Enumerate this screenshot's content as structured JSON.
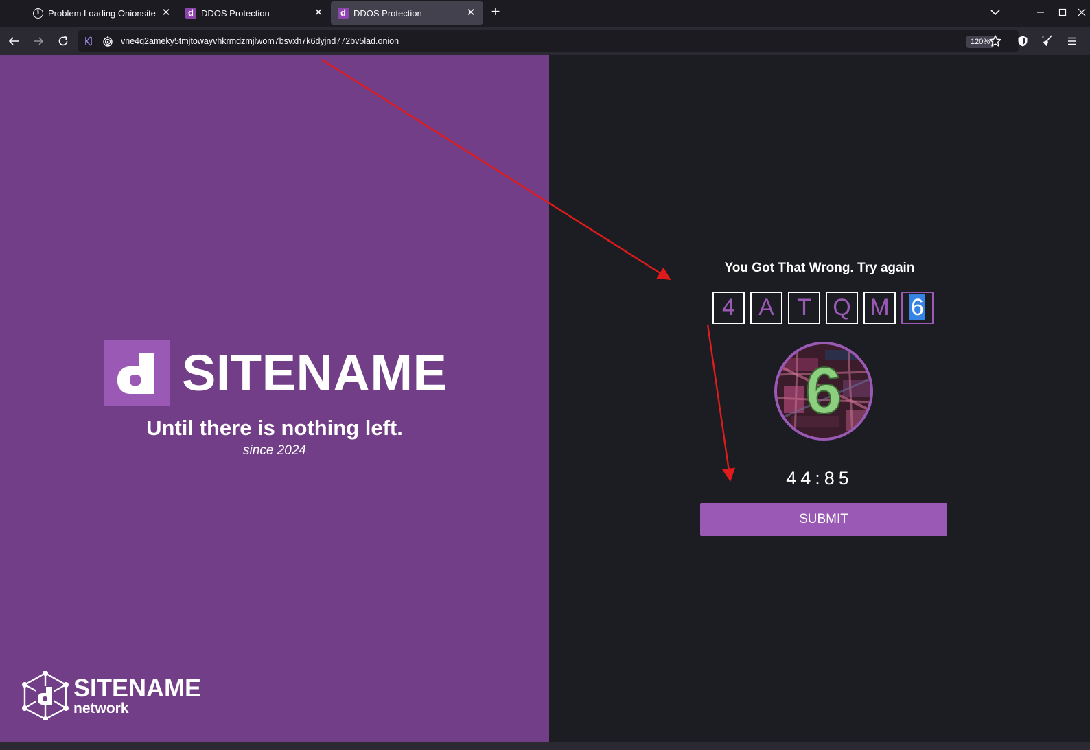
{
  "browser": {
    "tabs": [
      {
        "title": "Problem Loading Onionsite",
        "icon": "info-icon",
        "active": false
      },
      {
        "title": "DDOS Protection",
        "icon": "site-favicon",
        "active": false
      },
      {
        "title": "DDOS Protection",
        "icon": "site-favicon",
        "active": true
      }
    ],
    "favicon_letter": "d",
    "url": "vne4q2ameky5tmjtowayvhkrmdzmjlwom7bsvxh7k6dyjnd772bv5lad.onion",
    "zoom": "120%"
  },
  "left": {
    "logo_letter": "d",
    "site_name": "SITENAME",
    "tagline": "Until there is nothing left.",
    "since": "since 2024",
    "network_name": "SITENAME",
    "network_sub": "network"
  },
  "right": {
    "error_message": "You Got That Wrong. Try again",
    "code": [
      "4",
      "A",
      "T",
      "Q",
      "M",
      "6"
    ],
    "captcha_char": "6",
    "timer": "44:85",
    "submit_label": "SUBMIT"
  },
  "colors": {
    "left_bg": "#723e87",
    "right_bg": "#1c1d22",
    "accent": "#9b59b6",
    "annotation_arrow": "#e01b1b"
  }
}
